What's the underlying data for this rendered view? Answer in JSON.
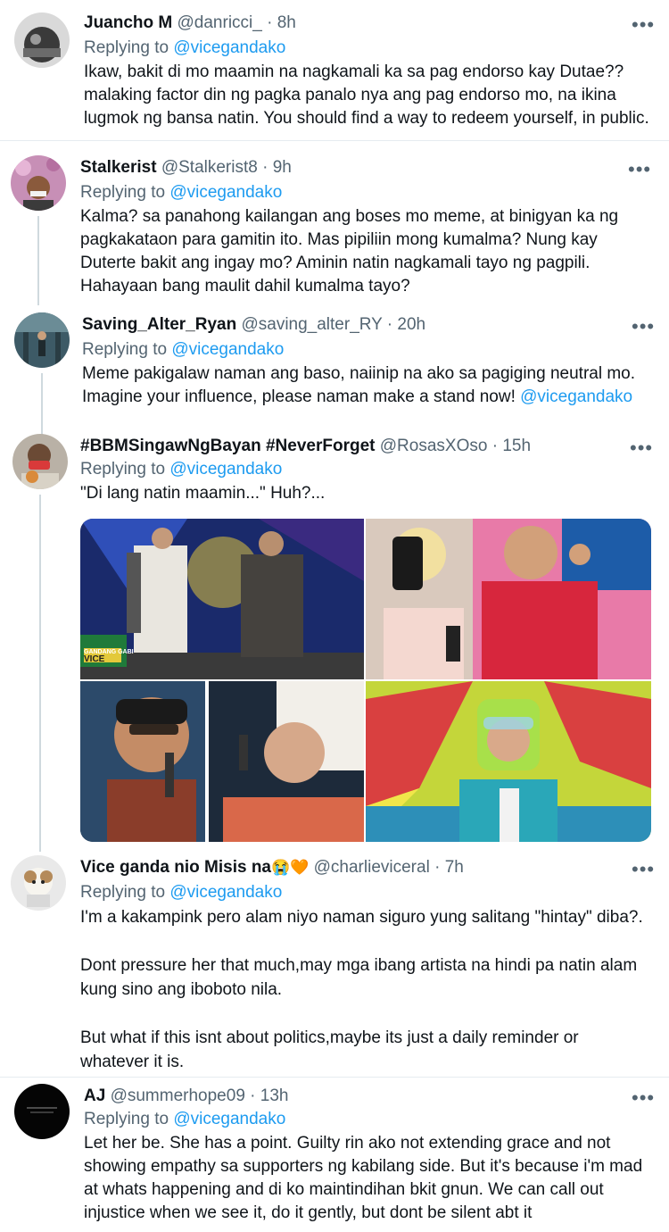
{
  "tweets": [
    {
      "name": "Juancho M",
      "handle": "@danricci_",
      "time": "8h",
      "replying_label": "Replying to",
      "replying_to": "@vicegandako",
      "text": "Ikaw, bakit di mo maamin na nagkamali ka sa pag endorso kay Dutae??\nmalaking factor din ng pagka panalo nya ang pag endorso mo, na ikina\nlugmok ng bansa natin. You should find a way to redeem yourself, in public."
    },
    {
      "name": "Stalkerist",
      "handle": "@Stalkerist8",
      "time": "9h",
      "replying_label": "Replying to",
      "replying_to": "@vicegandako",
      "text": "Kalma? sa panahong kailangan ang boses mo meme, at binigyan ka ng\npagkakataon para gamitin ito. Mas pipiliin mong kumalma? Nung kay\nDuterte bakit ang ingay mo? Aminin natin nagkamali tayo ng pagpili.\nHahayaan bang maulit dahil kumalma tayo?"
    },
    {
      "name": "Saving_Alter_Ryan",
      "handle": "@saving_alter_RY",
      "time": "20h",
      "replying_label": "Replying to",
      "replying_to": "@vicegandako",
      "text_line1": "Meme pakigalaw naman ang baso, naiinip na ako sa pagiging neutral mo.",
      "text_line2": "Imagine your influence, please naman make a stand now!",
      "text_mention": "@vicegandako"
    },
    {
      "name": "#BBMSingawNgBayan #NeverForget",
      "handle": "@RosasXOso",
      "time": "15h",
      "replying_label": "Replying to",
      "replying_to": "@vicegandako",
      "text": "\"Di lang natin maamin...\" Huh?...",
      "media_overlay_text": [
        "GANDANG GABI",
        "VICE"
      ]
    },
    {
      "name": "Vice ganda nio Misis na",
      "name_emojis": "😭🧡",
      "handle": "@charlieviceral",
      "time": "7h",
      "replying_label": "Replying to",
      "replying_to": "@vicegandako",
      "text": "I'm a kakampink pero alam niyo naman siguro yung salitang \"hintay\" diba?.\n\nDont pressure her that much,may mga ibang artista na hindi pa natin alam\nkung sino ang iboboto nila.\n\nBut what if this isnt about politics,maybe its just a daily reminder or\nwhatever it is."
    },
    {
      "name": "AJ",
      "handle": "@summerhope09",
      "time": "13h",
      "replying_label": "Replying to",
      "replying_to": "@vicegandako",
      "text": "Let her be. She has a point. Guilty rin ako not extending grace and not\nshowing empathy sa supporters ng kabilang side. But it's because i'm mad\nat whats happening and di ko maintindihan bkit gnun. We can call out\ninjustice when we see it, do it gently, but dont be silent abt it"
    }
  ],
  "separator": "·",
  "more_glyph": "•••",
  "colors": {
    "text": "#0f1419",
    "secondary": "#536471",
    "link": "#1d9bf0",
    "thread_line": "#cfd9de"
  }
}
